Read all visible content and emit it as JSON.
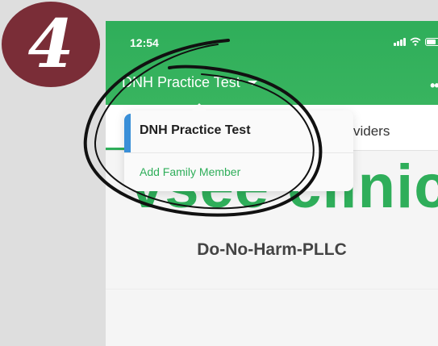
{
  "step": {
    "number": "4"
  },
  "status_bar": {
    "time": "12:54"
  },
  "header": {
    "account_name": "DNH Practice Test",
    "more_label": "•••"
  },
  "tabs": {
    "providers_label": "viders"
  },
  "main": {
    "brand_text": "vsee clinic",
    "clinic_name": "Do-No-Harm-PLLC"
  },
  "dropdown": {
    "current_account": "DNH Practice Test",
    "add_member_label": "Add Family Member"
  },
  "colors": {
    "accent_green": "#2fae5a",
    "step_badge": "#7a2d37",
    "accent_blue": "#3a8fd8"
  },
  "icons": {
    "signal": "signal-icon",
    "wifi": "wifi-icon",
    "battery": "battery-icon",
    "caret": "caret-down-icon",
    "more": "more-icon"
  }
}
